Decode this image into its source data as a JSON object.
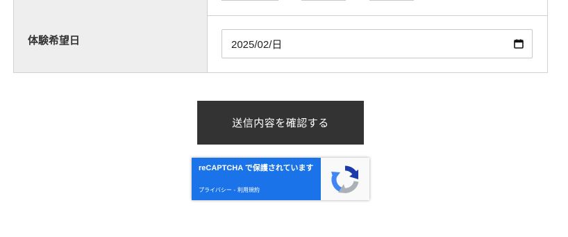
{
  "form": {
    "date_row": {
      "label": "体験希望日",
      "date_value": "2025/02/日"
    }
  },
  "submit": {
    "label": "送信内容を確認する"
  },
  "recaptcha": {
    "title": "reCAPTCHA で保護されています",
    "privacy_label": "プライバシー",
    "separator": " - ",
    "terms_label": "利用規約",
    "colors": {
      "badge_blue": "#1a73e8",
      "logo_blue": "#1c3aa9",
      "logo_lightblue": "#4285f4",
      "logo_gray": "#abb1b8"
    }
  },
  "colors": {
    "button_bg": "#333333",
    "label_bg": "#eeeeee",
    "border": "#d0d0d0"
  },
  "icons": [
    "calendar-icon",
    "recaptcha-logo-icon"
  ]
}
